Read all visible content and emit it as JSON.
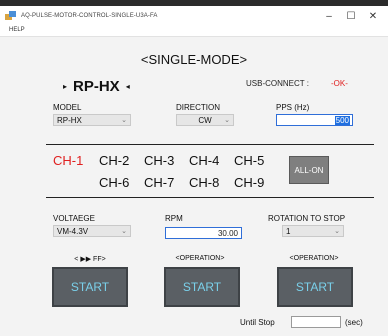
{
  "window": {
    "title": "AQ-PULSE-MOTOR-CONTROL-SINGLE-U3A-FA",
    "controls": {
      "minimize": "–",
      "maximize": "☐",
      "close": "✕"
    }
  },
  "menu": {
    "items": [
      "HELP"
    ]
  },
  "mode_title": "<SINGLE-MODE>",
  "model_header": {
    "left_marker": "▸",
    "name": "RP-HX",
    "right_marker": "◂"
  },
  "usb": {
    "label": "USB-CONNECT :",
    "status": "-OK-",
    "status_color": "#e02020"
  },
  "model": {
    "label": "MODEL",
    "value": "RP-HX"
  },
  "direction": {
    "label": "DIRECTION",
    "value": "CW"
  },
  "pps": {
    "label": "PPS (Hz)",
    "value": "500"
  },
  "channels": {
    "row1": [
      "CH-1",
      "CH-2",
      "CH-3",
      "CH-4",
      "CH-5"
    ],
    "row2": [
      "CH-6",
      "CH-7",
      "CH-8",
      "CH-9"
    ],
    "active": "CH-1"
  },
  "all_on_label": "ALL-ON",
  "voltage": {
    "label": "VOLTAEGE",
    "value": "VM-4.3V"
  },
  "rpm": {
    "label": "RPM",
    "value": "30.00"
  },
  "rotation": {
    "label": "ROTATION TO STOP",
    "value": "1"
  },
  "operations": [
    {
      "label": "< ▶▶ FF>",
      "button": "START"
    },
    {
      "label": "<OPERATION>",
      "button": "START"
    },
    {
      "label": "<OPERATION>",
      "button": "START"
    }
  ],
  "until_stop": {
    "label": "Until Stop",
    "value": "",
    "unit": "(sec)"
  },
  "colors": {
    "accent": "#2f6ed8",
    "start_text": "#7ad0ea",
    "start_bg": "#5a5f64",
    "active_channel": "#e02020"
  }
}
